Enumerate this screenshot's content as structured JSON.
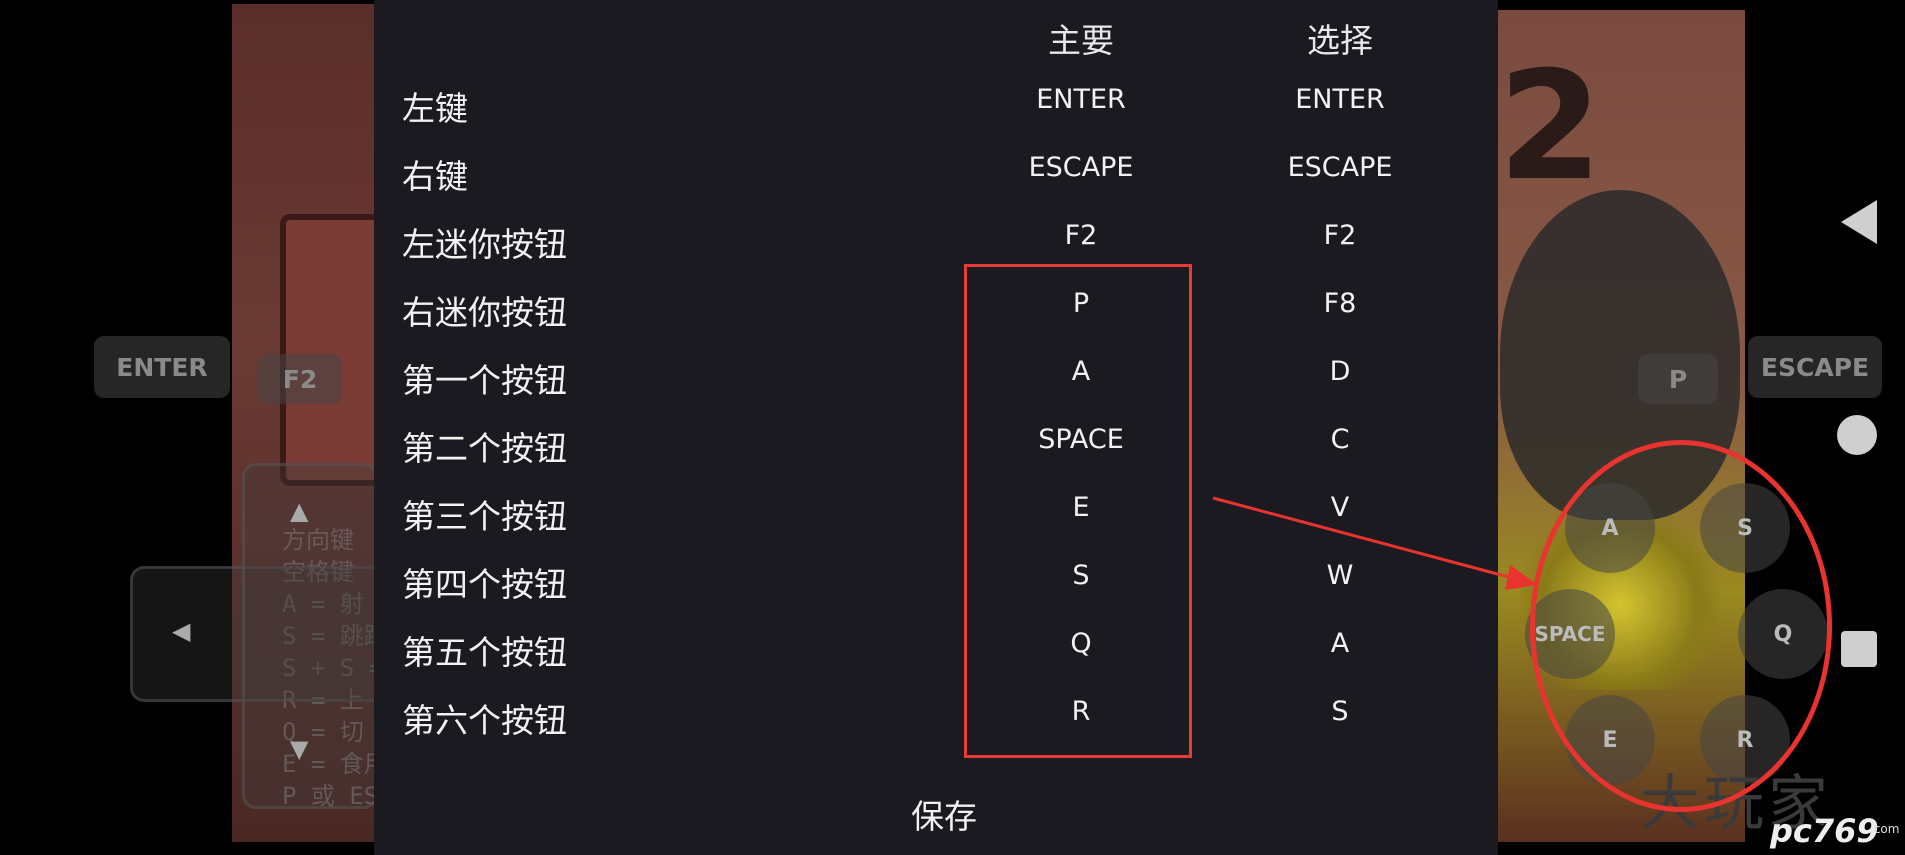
{
  "dialog": {
    "headers": {
      "primary": "主要",
      "secondary": "选择"
    },
    "rows": [
      {
        "label": "左键",
        "primary": "ENTER",
        "secondary": "ENTER"
      },
      {
        "label": "右键",
        "primary": "ESCAPE",
        "secondary": "ESCAPE"
      },
      {
        "label": "左迷你按钮",
        "primary": "F2",
        "secondary": "F2"
      },
      {
        "label": "右迷你按钮",
        "primary": "P",
        "secondary": "F8"
      },
      {
        "label": "第一个按钮",
        "primary": "A",
        "secondary": "D"
      },
      {
        "label": "第二个按钮",
        "primary": "SPACE",
        "secondary": "C"
      },
      {
        "label": "第三个按钮",
        "primary": "E",
        "secondary": "V"
      },
      {
        "label": "第四个按钮",
        "primary": "S",
        "secondary": "W"
      },
      {
        "label": "第五个按钮",
        "primary": "Q",
        "secondary": "A"
      },
      {
        "label": "第六个按钮",
        "primary": "R",
        "secondary": "S"
      }
    ],
    "save_label": "保存"
  },
  "overlay": {
    "enter": "ENTER",
    "f2": "F2",
    "p": "P",
    "escape": "ESCAPE",
    "round_buttons": {
      "a": "A",
      "s": "S",
      "space": "SPACE",
      "q": "Q",
      "e": "E",
      "r": "R"
    }
  },
  "background": {
    "help_lines": [
      "方向键",
      "空格键",
      "A = 射",
      "S = 跳跃",
      "S + S =",
      "R = 上",
      "Q = 切",
      "E = 食用",
      "P 或 ES"
    ],
    "watermark": "大玩家",
    "site_logo": "pc769",
    "site_suffix": ".com"
  },
  "colors": {
    "dialog_bg": "#1b1a20",
    "annotation": "#e8332e"
  }
}
